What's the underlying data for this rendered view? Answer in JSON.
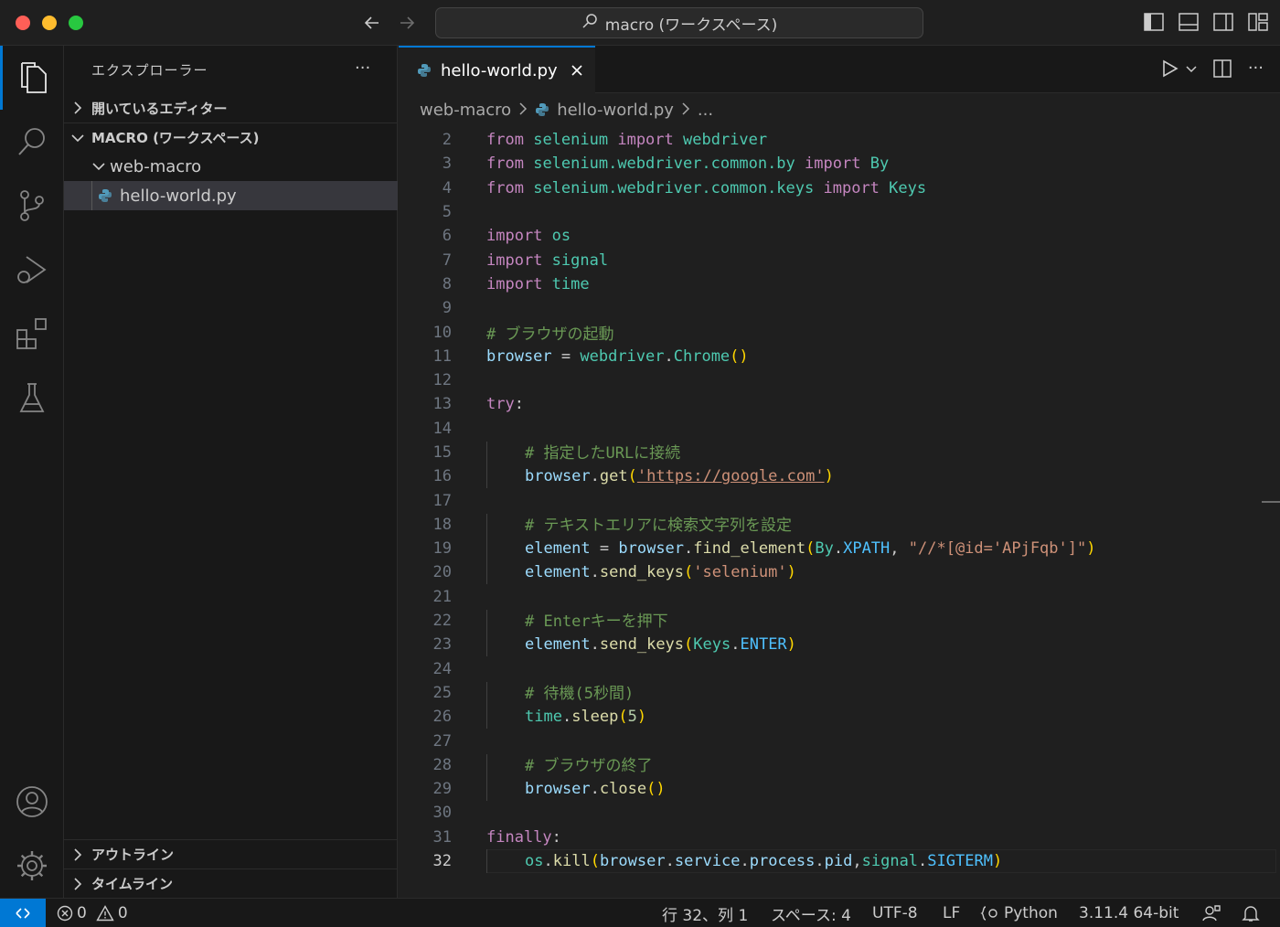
{
  "titlebar": {
    "search_text": "macro (ワークスペース)"
  },
  "sidebar": {
    "title": "エクスプローラー",
    "more": "···",
    "open_editors": "開いているエディター",
    "workspace": "MACRO (ワークスペース)",
    "folder": "web-macro",
    "file": "hello-world.py",
    "outline": "アウトライン",
    "timeline": "タイムライン"
  },
  "editor": {
    "tab_label": "hello-world.py",
    "breadcrumb": [
      "web-macro",
      "hello-world.py",
      "..."
    ],
    "line_numbers": [
      "2",
      "3",
      "4",
      "5",
      "6",
      "7",
      "8",
      "9",
      "10",
      "11",
      "12",
      "13",
      "14",
      "15",
      "16",
      "17",
      "18",
      "19",
      "20",
      "21",
      "22",
      "23",
      "24",
      "25",
      "26",
      "27",
      "28",
      "29",
      "30",
      "31",
      "32"
    ],
    "current_line": "32",
    "code": {
      "l2": [
        "from",
        "selenium",
        "import",
        "webdriver"
      ],
      "l3": [
        "from",
        "selenium.webdriver.common.by",
        "import",
        "By"
      ],
      "l4": [
        "from",
        "selenium.webdriver.common.keys",
        "import",
        "Keys"
      ],
      "l6": [
        "import",
        "os"
      ],
      "l7": [
        "import",
        "signal"
      ],
      "l8": [
        "import",
        "time"
      ],
      "l10": "# ブラウザの起動",
      "l11": [
        "browser",
        " = ",
        "webdriver",
        ".",
        "Chrome",
        "()"
      ],
      "l13": [
        "try",
        ":"
      ],
      "l15": "# 指定したURLに接続",
      "l16": [
        "browser",
        ".",
        "get",
        "(",
        "'https://google.com'",
        ")"
      ],
      "l18": "# テキストエリアに検索文字列を設定",
      "l19": [
        "element",
        " = ",
        "browser",
        ".",
        "find_element",
        "(",
        "By",
        ".",
        "XPATH",
        ", ",
        "\"//*[@id='APjFqb']\"",
        ")"
      ],
      "l20": [
        "element",
        ".",
        "send_keys",
        "(",
        "'selenium'",
        ")"
      ],
      "l22": "# Enterキーを押下",
      "l23": [
        "element",
        ".",
        "send_keys",
        "(",
        "Keys",
        ".",
        "ENTER",
        ")"
      ],
      "l25": "# 待機(5秒間)",
      "l26": [
        "time",
        ".",
        "sleep",
        "(",
        "5",
        ")"
      ],
      "l28": "# ブラウザの終了",
      "l29": [
        "browser",
        ".",
        "close",
        "()"
      ],
      "l31": [
        "finally",
        ":"
      ],
      "l32": [
        "os",
        ".",
        "kill",
        "(",
        "browser",
        ".",
        "service",
        ".",
        "process",
        ".",
        "pid",
        ",",
        "signal",
        ".",
        "SIGTERM",
        ")"
      ]
    }
  },
  "statusbar": {
    "errors": "0",
    "warnings": "0",
    "position": "行 32、列 1",
    "spaces": "スペース: 4",
    "encoding": "UTF-8",
    "eol": "LF",
    "language": "Python",
    "interpreter": "3.11.4 64-bit"
  },
  "colors": {
    "accent": "#0078d4",
    "keyword": "#c586c0",
    "comment": "#6a9955",
    "string": "#ce9178"
  }
}
